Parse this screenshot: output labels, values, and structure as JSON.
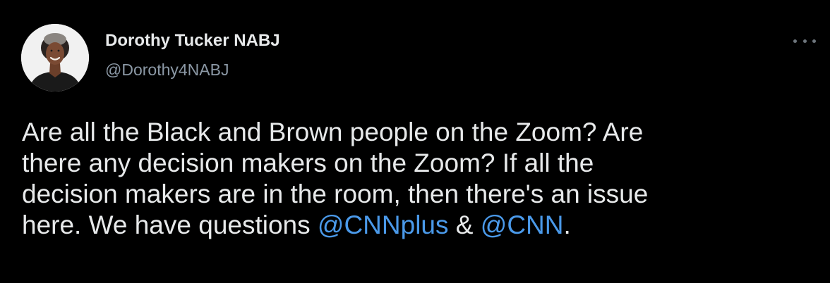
{
  "author": {
    "display_name": "Dorothy Tucker NABJ",
    "handle": "@Dorothy4NABJ",
    "avatar_icon": "profile-photo"
  },
  "more_menu": {
    "icon": "more-horizontal-icon"
  },
  "tweet": {
    "line1": "Are all the Black and Brown people on the Zoom? Are",
    "line2": "there any decision makers on the Zoom? If all the",
    "line3": "decision makers are in the room, then there's an issue",
    "line4_prefix": "here. We have questions ",
    "mention1": "@CNNplus",
    "amp": " & ",
    "mention2": "@CNN",
    "line4_suffix": "."
  },
  "colors": {
    "background": "#000000",
    "text": "#e7e9ea",
    "secondary": "#8b98a5",
    "link": "#4a99e9"
  }
}
